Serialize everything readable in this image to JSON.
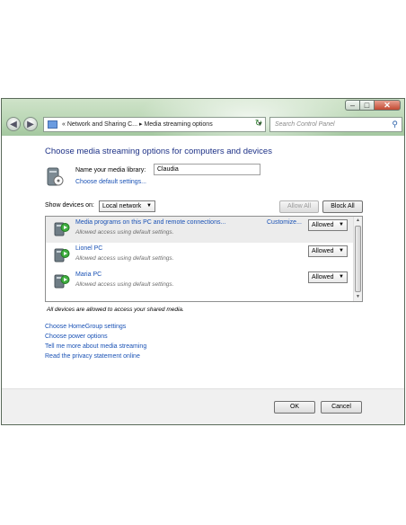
{
  "window": {
    "controls": {
      "minimize": "–",
      "maximize": "□",
      "close": "✕"
    },
    "address": {
      "crumb_prefix": "«",
      "crumb1": "Network and Sharing C...",
      "separator": "▸",
      "crumb2": "Media streaming options"
    },
    "search_placeholder": "Search Control Panel"
  },
  "page": {
    "title": "Choose media streaming options for computers and devices",
    "library_label": "Name your media library:",
    "library_value": "Claudia",
    "choose_default_link": "Choose default settings...",
    "show_devices_label": "Show devices on:",
    "show_devices_value": "Local network",
    "allow_all_label": "Allow All",
    "block_all_label": "Block All",
    "devices": [
      {
        "name": "Media programs on this PC and remote connections...",
        "status": "Allowed access using default settings.",
        "customize": "Customize...",
        "permission": "Allowed"
      },
      {
        "name": "Lionel PC",
        "status": "Allowed access using default settings.",
        "permission": "Allowed"
      },
      {
        "name": "Maria PC",
        "status": "Allowed access using default settings.",
        "permission": "Allowed"
      }
    ],
    "all_devices_note": "All devices are allowed to access your shared media.",
    "links": [
      "Choose HomeGroup settings",
      "Choose power options",
      "Tell me more about media streaming",
      "Read the privacy statement online"
    ],
    "ok_label": "OK",
    "cancel_label": "Cancel"
  },
  "icons": {
    "back": "back-arrow-icon",
    "forward": "forward-arrow-icon",
    "refresh": "refresh-icon",
    "search": "search-icon",
    "library": "media-library-icon",
    "device": "media-device-icon"
  }
}
